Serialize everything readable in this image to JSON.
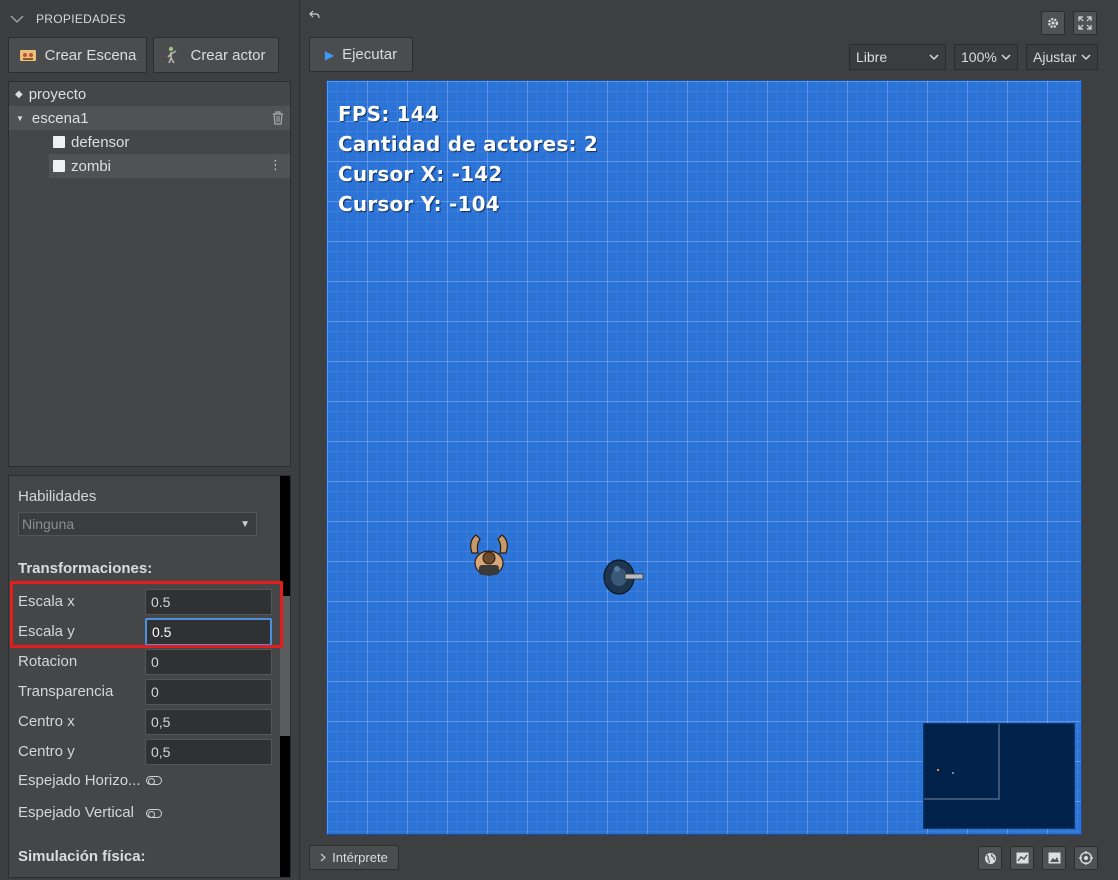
{
  "panel_title": "PROPIEDADES",
  "toolbar": {
    "crear_escena": "Crear Escena",
    "crear_actor": "Crear actor",
    "ejecutar": "Ejecutar"
  },
  "tree": {
    "project": "proyecto",
    "scene": "escena1",
    "actors": [
      "defensor",
      "zombi"
    ]
  },
  "properties": {
    "habilidades_label": "Habilidades",
    "habilidades_value": "Ninguna",
    "transform_header": "Transformaciones:",
    "fields": [
      {
        "label": "Escala x",
        "value": "0.5"
      },
      {
        "label": "Escala y",
        "value": "0.5"
      },
      {
        "label": "Rotacion",
        "value": "0"
      },
      {
        "label": "Transparencia",
        "value": "0"
      },
      {
        "label": "Centro x",
        "value": "0,5"
      },
      {
        "label": "Centro y",
        "value": "0,5"
      }
    ],
    "mirror_h": "Espejado Horizo...",
    "mirror_v": "Espejado Vertical",
    "physics_header": "Simulación física:"
  },
  "view_controls": {
    "mode": "Libre",
    "zoom": "100%",
    "fit": "Ajustar"
  },
  "hud": {
    "fps": "FPS: 144",
    "actors": "Cantidad de actores: 2",
    "cursor_x": "Cursor X: -142",
    "cursor_y": "Cursor Y: -104"
  },
  "footer": {
    "interprete": "Intérprete"
  },
  "icons": [
    "chevron-down-icon",
    "scene-icon",
    "actor-icon",
    "diamond-icon",
    "triangle-down-icon",
    "trash-icon",
    "kebab-icon",
    "undo-icon",
    "play-icon",
    "gear-icon",
    "fullscreen-icon",
    "globe-icon",
    "chart-icon",
    "image-icon",
    "crosshair-icon",
    "chevron-right-icon"
  ],
  "colors": {
    "accent": "#2b73d6",
    "highlight": "#e41c1c",
    "focus": "#4a8fe0"
  }
}
